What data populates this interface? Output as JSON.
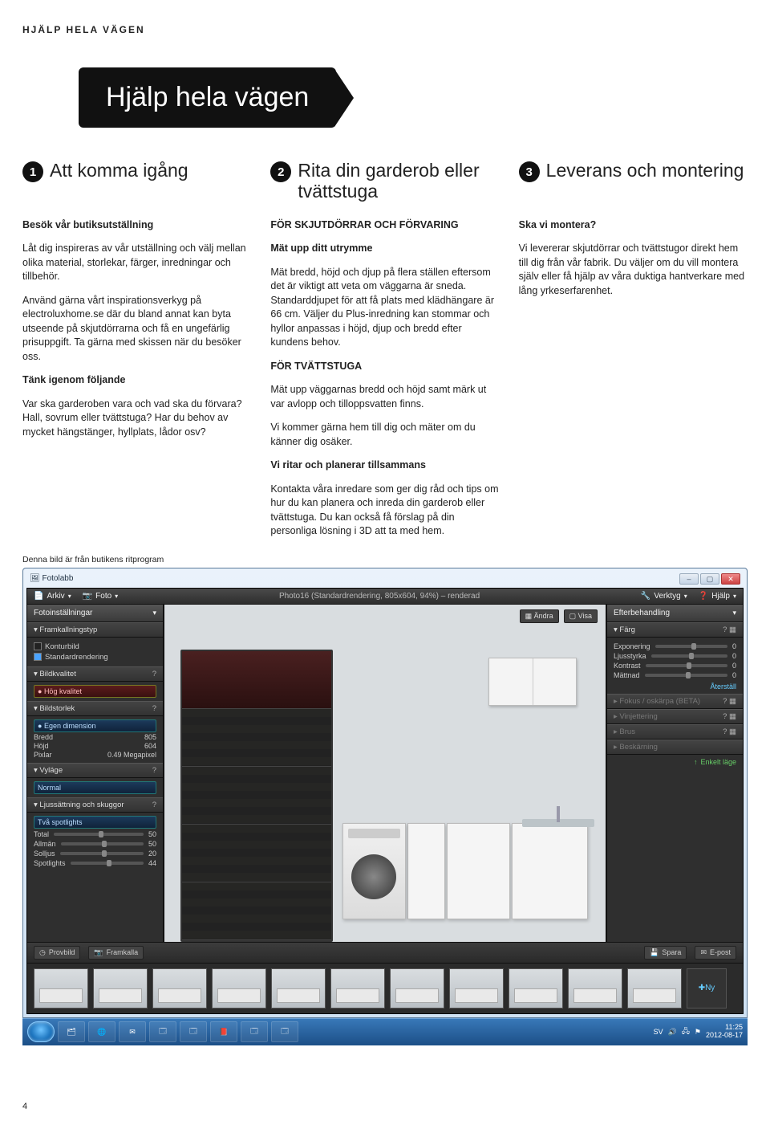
{
  "header": {
    "kicker": "HJÄLP HELA VÄGEN"
  },
  "title_badge": "Hjälp hela vägen",
  "steps": [
    {
      "num": "1",
      "title": "Att komma igång"
    },
    {
      "num": "2",
      "title": "Rita din garderob eller tvättstuga"
    },
    {
      "num": "3",
      "title": "Leverans och montering"
    }
  ],
  "col1": {
    "h1": "Besök vår butiksutställning",
    "p1": "Låt dig inspireras av vår utställning och välj mellan olika material, storlekar, färger, inredningar och tillbehör.",
    "p2": "Använd gärna vårt inspirationsverkyg på electroluxhome.se där du bland annat kan byta utseende på skjutdörrarna och få en ungefärlig prisuppgift. Ta gärna med skissen när du besöker oss.",
    "h2": "Tänk igenom följande",
    "p3": "Var ska garderoben vara och vad ska du förvara? Hall, sovrum eller tvättstuga? Har du behov av mycket hängstänger, hyllplats, lådor osv?"
  },
  "col2": {
    "h1": "FÖR SKJUTDÖRRAR OCH FÖRVARING",
    "h2": "Mät upp ditt utrymme",
    "p1": "Mät bredd, höjd och djup på flera ställen eftersom det är viktigt att veta om väggarna är sneda. Standarddjupet för att få plats med klädhängare är 66 cm. Väljer du Plus-inredning kan stommar och hyllor anpassas i höjd, djup och bredd efter kundens behov.",
    "h3": "FÖR TVÄTTSTUGA",
    "p2": "Mät upp väggarnas bredd och höjd samt märk ut var avlopp och tilloppsvatten finns.",
    "p3": "Vi kommer gärna hem till dig och mäter om du känner dig osäker.",
    "h4": "Vi ritar och planerar tillsammans",
    "p4": "Kontakta våra inredare som ger dig råd och tips om hur du kan planera och inreda din garderob eller tvättstuga. Du kan också få förslag på din personliga lösning i 3D att ta med hem."
  },
  "col3": {
    "h1": "Ska vi montera?",
    "p1": "Vi levererar skjutdörrar och tvättstugor direkt hem till dig från vår fabrik. Du väljer om du vill montera själv eller få hjälp av våra duktiga hantverkare med lång yrkeserfarenhet."
  },
  "caption": "Denna bild är från butikens ritprogram",
  "app": {
    "window_title": "Fotolabb",
    "menu_arkiv": "Arkiv",
    "menu_foto": "Foto",
    "render_title": "Photo16 (Standardrendering, 805x604, 94%) – renderad",
    "menu_verktyg": "Verktyg",
    "menu_hjalp": "Hjälp",
    "left_panel_title": "Fotoinställningar",
    "sec_framkallning": "Framkallningstyp",
    "opt_konturbild": "Konturbild",
    "opt_standard": "Standardrendering",
    "sec_bildkvalitet": "Bildkvalitet",
    "opt_hog": "Hög kvalitet",
    "sec_bildstorlek": "Bildstorlek",
    "opt_egen": "Egen dimension",
    "kv_bredd_k": "Bredd",
    "kv_bredd_v": "805",
    "kv_hojd_k": "Höjd",
    "kv_hojd_v": "604",
    "kv_pixlar_k": "Pixlar",
    "kv_pixlar_v": "0.49 Megapixel",
    "sec_vylage": "Vyläge",
    "opt_normal": "Normal",
    "sec_ljus": "Ljussättning och skuggor",
    "opt_spot": "Två spotlights",
    "kv_total_k": "Total",
    "kv_total_v": "50",
    "kv_allman_k": "Allmän",
    "kv_allman_v": "50",
    "kv_solljus_k": "Solljus",
    "kv_solljus_v": "20",
    "kv_spot_k": "Spotlights",
    "kv_spot_v": "44",
    "btn_provbild": "Provbild",
    "btn_framkalla": "Framkalla",
    "view_btn_andra": "Ändra",
    "view_btn_visa": "Visa",
    "right_panel_title": "Efterbehandling",
    "sec_farg": "Färg",
    "kv_exp_k": "Exponering",
    "kv_exp_v": "0",
    "kv_ljus_k": "Ljusstyrka",
    "kv_ljus_v": "0",
    "kv_kon_k": "Kontrast",
    "kv_kon_v": "0",
    "kv_mat_k": "Mättnad",
    "kv_mat_v": "0",
    "reset": "Återställ",
    "sec_fokus": "Fokus / oskärpa (BETA)",
    "sec_vinjett": "Vinjettering",
    "sec_brus": "Brus",
    "sec_beskarning": "Beskärning",
    "green_enkelt": "Enkelt läge",
    "btn_spara": "Spara",
    "btn_epost": "E-post",
    "thumb_ny": "Ny",
    "taskbar_lang": "SV",
    "taskbar_time": "11:25",
    "taskbar_date": "2012-08-17"
  },
  "page_number": "4"
}
